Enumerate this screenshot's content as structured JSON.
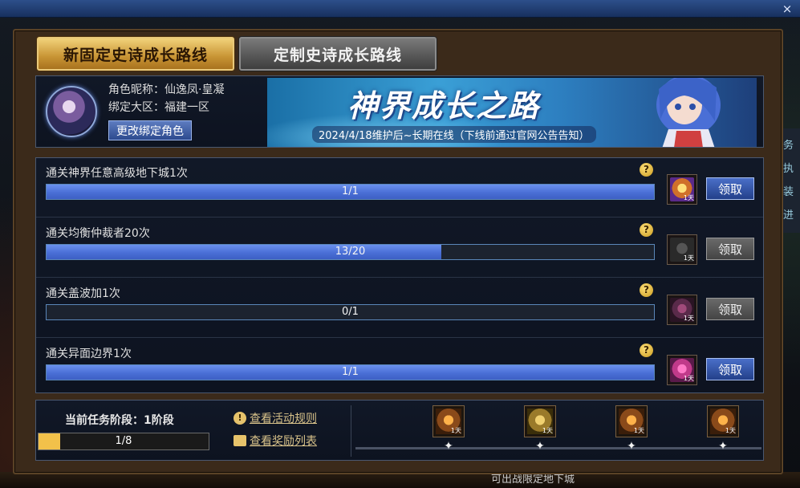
{
  "window": {
    "close_glyph": "×"
  },
  "tabs": [
    {
      "label": "新固定史诗成长路线",
      "active": true
    },
    {
      "label": "定制史诗成长路线",
      "active": false
    }
  ],
  "profile": {
    "nickname_line": "角色昵称：仙逸凤·皇凝",
    "server_line": "绑定大区：福建一区",
    "change_button": "更改绑定角色"
  },
  "banner": {
    "title": "神界成长之路",
    "subtitle": "2024/4/18维护后~长期在线（下线前通过官网公告告知）"
  },
  "tasks": [
    {
      "label": "通关神界任意高级地下城1次",
      "progress_text": "1/1",
      "progress": 1.0,
      "claim": "领取",
      "claim_enabled": true,
      "reward_tag": "1天"
    },
    {
      "label": "通关均衡仲裁者20次",
      "progress_text": "13/20",
      "progress": 0.65,
      "claim": "领取",
      "claim_enabled": false,
      "reward_tag": "1天"
    },
    {
      "label": "通关盖波加1次",
      "progress_text": "0/1",
      "progress": 0.0,
      "claim": "领取",
      "claim_enabled": false,
      "reward_tag": "1天"
    },
    {
      "label": "通关异面边界1次",
      "progress_text": "1/1",
      "progress": 1.0,
      "claim": "领取",
      "claim_enabled": true,
      "reward_tag": "1天"
    }
  ],
  "help_glyph": "?",
  "stage": {
    "label": "当前任务阶段：1阶段",
    "progress_text": "1/8",
    "progress": 0.125
  },
  "links": {
    "rules": "查看活动规则",
    "rewards": "查看奖励列表",
    "rules_icon_glyph": "!"
  },
  "stage_reward_tag": "1天",
  "star_glyph": "✦",
  "side_text": [
    "务",
    "执",
    "装",
    "进"
  ],
  "bottom_strip_text": "可出战限定地下城",
  "colors": {
    "progress_fill": "#4a6fd6",
    "stage_fill": "#f2c14a",
    "tab_active": "#c89434"
  }
}
